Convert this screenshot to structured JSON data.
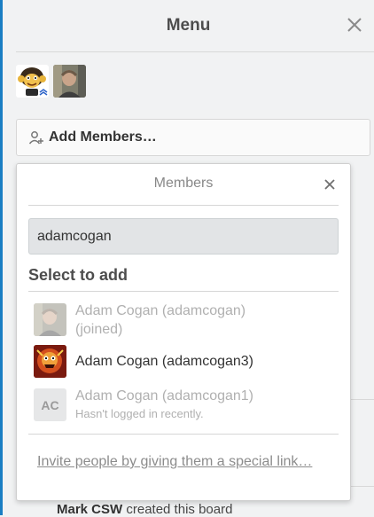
{
  "menu": {
    "title": "Menu",
    "close_icon": "close-icon",
    "add_members_label": "Add Members…",
    "add_members_icon": "add-person-icon"
  },
  "board_members": [
    {
      "kind": "monkey-avatar"
    },
    {
      "kind": "photo-avatar"
    }
  ],
  "popover": {
    "title": "Members",
    "search_value": "adamcogan",
    "section_heading": "Select to add",
    "results": [
      {
        "name": "Adam Cogan (adamcogan)",
        "status": "(joined)",
        "state": "disabled"
      },
      {
        "name": "Adam Cogan (adamcogan3)",
        "state": "available"
      },
      {
        "name": "Adam Cogan (adamcogan1)",
        "status": "Hasn't logged in recently.",
        "initials": "AC",
        "state": "disabled"
      }
    ],
    "invite_link": "Invite people by giving them a special link…"
  },
  "activity": {
    "author": "Mark CSW",
    "text": "created this board"
  },
  "colors": {
    "accent": "#1a7ec3",
    "panel_bg": "#f1f2f3",
    "input_bg": "#e2e4e6",
    "muted_text": "#b0b0b0"
  }
}
